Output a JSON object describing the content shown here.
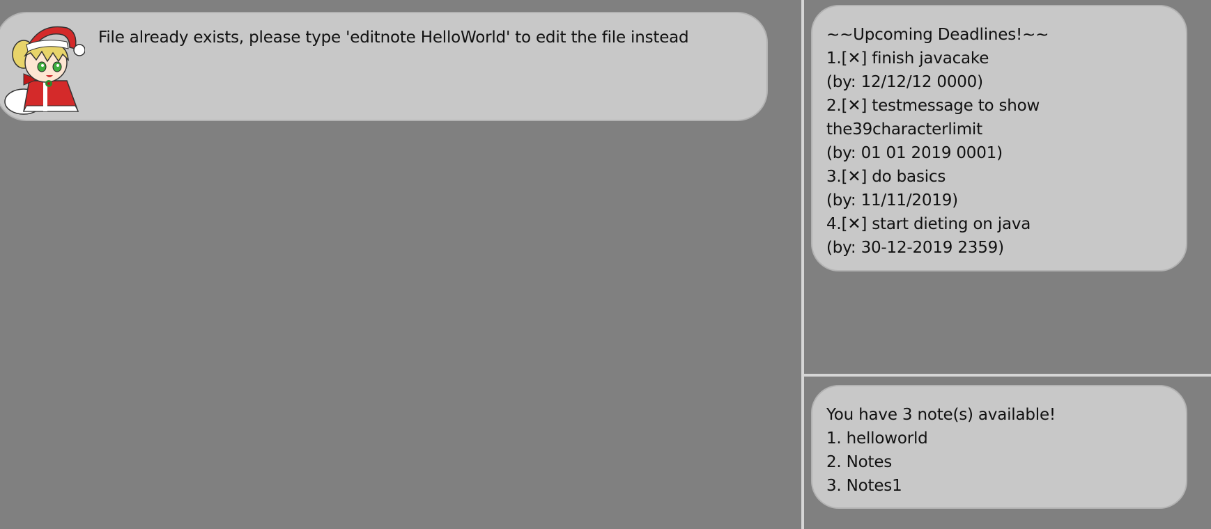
{
  "chat": {
    "messages": [
      {
        "sender": "bot",
        "text": "File already exists, please type 'editnote HelloWorld' to edit the file instead"
      }
    ]
  },
  "deadlines": {
    "lines": [
      "~~Upcoming Deadlines!~~",
      "1.[✕] finish javacake",
      "(by: 12/12/12 0000)",
      "2.[✕] testmessage to show",
      "the39characterlimit",
      "(by: 01 01 2019 0001)",
      "3.[✕] do basics",
      "(by: 11/11/2019)",
      "4.[✕] start dieting on java",
      "(by: 30-12-2019 2359)"
    ]
  },
  "notes": {
    "lines": [
      "You have 3 note(s) available!",
      "1. helloworld",
      "2. Notes",
      "3. Notes1"
    ]
  },
  "colors": {
    "background": "#808080",
    "bubble": "#c8c8c8",
    "divider": "#d6d6d6",
    "santa_hat": "#d42a2a",
    "hair": "#e8d46a"
  },
  "icons": {
    "avatar": "santa-girl-avatar"
  }
}
